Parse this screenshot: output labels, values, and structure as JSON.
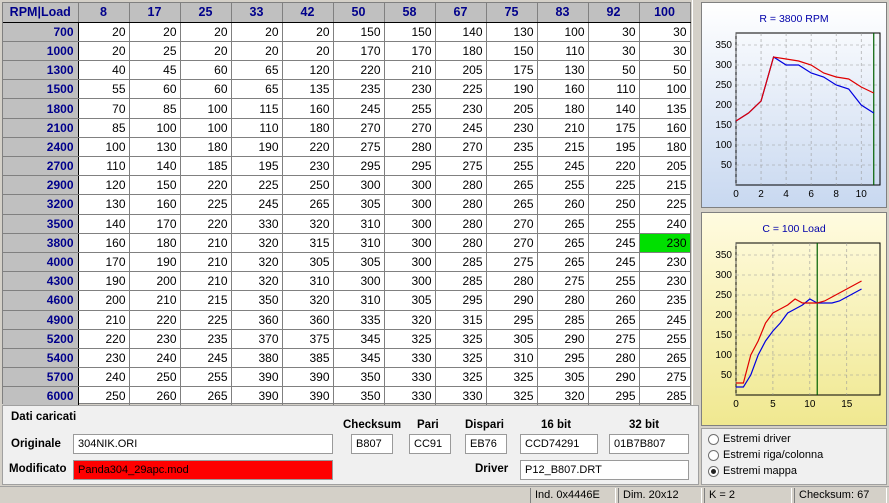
{
  "grid": {
    "corner": "RPM|Load",
    "loads": [
      "8",
      "17",
      "25",
      "33",
      "42",
      "50",
      "58",
      "67",
      "75",
      "83",
      "92",
      "100"
    ],
    "rpms": [
      "700",
      "1000",
      "1300",
      "1500",
      "1800",
      "2100",
      "2400",
      "2700",
      "2900",
      "3200",
      "3500",
      "3800",
      "4000",
      "4300",
      "4600",
      "4900",
      "5200",
      "5400",
      "5700",
      "6000"
    ],
    "values": [
      [
        20,
        20,
        20,
        20,
        20,
        150,
        150,
        140,
        130,
        100,
        30,
        30
      ],
      [
        20,
        25,
        20,
        20,
        20,
        170,
        170,
        180,
        150,
        110,
        30,
        30
      ],
      [
        40,
        45,
        60,
        65,
        120,
        220,
        210,
        205,
        175,
        130,
        50,
        50
      ],
      [
        55,
        60,
        60,
        65,
        135,
        235,
        230,
        225,
        190,
        160,
        110,
        100
      ],
      [
        70,
        85,
        100,
        115,
        160,
        245,
        255,
        230,
        205,
        180,
        140,
        135
      ],
      [
        85,
        100,
        100,
        110,
        180,
        270,
        270,
        245,
        230,
        210,
        175,
        160
      ],
      [
        100,
        130,
        180,
        190,
        220,
        275,
        280,
        270,
        235,
        215,
        195,
        180
      ],
      [
        110,
        140,
        185,
        195,
        230,
        295,
        295,
        275,
        255,
        245,
        220,
        205
      ],
      [
        120,
        150,
        220,
        225,
        250,
        300,
        300,
        280,
        265,
        255,
        225,
        215
      ],
      [
        130,
        160,
        225,
        245,
        265,
        305,
        300,
        280,
        265,
        260,
        250,
        225
      ],
      [
        140,
        170,
        220,
        330,
        320,
        310,
        300,
        280,
        270,
        265,
        255,
        240
      ],
      [
        160,
        180,
        210,
        320,
        315,
        310,
        300,
        280,
        270,
        265,
        245,
        230
      ],
      [
        170,
        190,
        210,
        320,
        305,
        305,
        300,
        285,
        275,
        265,
        245,
        230
      ],
      [
        190,
        200,
        210,
        320,
        310,
        300,
        300,
        285,
        280,
        275,
        255,
        230
      ],
      [
        200,
        210,
        215,
        350,
        320,
        310,
        305,
        295,
        290,
        280,
        260,
        235
      ],
      [
        210,
        220,
        225,
        360,
        360,
        335,
        320,
        315,
        295,
        285,
        265,
        245
      ],
      [
        220,
        230,
        235,
        370,
        375,
        345,
        325,
        325,
        305,
        290,
        275,
        255
      ],
      [
        230,
        240,
        245,
        380,
        385,
        345,
        330,
        325,
        310,
        295,
        280,
        265
      ],
      [
        240,
        250,
        255,
        390,
        390,
        350,
        330,
        325,
        325,
        305,
        290,
        275
      ],
      [
        250,
        260,
        265,
        390,
        390,
        350,
        330,
        330,
        325,
        320,
        295,
        285
      ]
    ],
    "highlight": {
      "row": 11,
      "col": 11
    }
  },
  "chart_top": {
    "title": "R = 3800 RPM",
    "yticks": [
      "350",
      "300",
      "250",
      "200",
      "150",
      "100",
      "50"
    ],
    "xticks": [
      "0",
      "2",
      "4",
      "6",
      "8",
      "10"
    ],
    "red": [
      160,
      180,
      210,
      320,
      315,
      310,
      300,
      280,
      270,
      265,
      245,
      230
    ],
    "blue": [
      160,
      180,
      210,
      320,
      300,
      300,
      280,
      270,
      250,
      240,
      200,
      180
    ],
    "colors": {
      "red": "#e00000",
      "blue": "#0000e0"
    }
  },
  "chart_bottom": {
    "title": "C = 100 Load",
    "yticks": [
      "350",
      "300",
      "250",
      "200",
      "150",
      "100",
      "50"
    ],
    "xticks": [
      "0",
      "5",
      "10",
      "15"
    ],
    "red": [
      30,
      30,
      100,
      135,
      180,
      205,
      215,
      225,
      240,
      230,
      230,
      230,
      235,
      245,
      255,
      265,
      275,
      285
    ],
    "blue": [
      20,
      20,
      50,
      100,
      135,
      160,
      180,
      205,
      215,
      225,
      240,
      230,
      230,
      230,
      235,
      245,
      255,
      265
    ]
  },
  "info": {
    "section_title": "Dati caricati",
    "original_label": "Originale",
    "original_value": "304NIK.ORI",
    "modified_label": "Modificato",
    "modified_value": "Panda304_29apc.mod",
    "checksum_label": "Checksum",
    "checksum_value": "B807",
    "pari_label": "Pari",
    "pari_value": "CC91",
    "dispari_label": "Dispari",
    "dispari_value": "EB76",
    "bit16_label": "16 bit",
    "bit16_value": "CCD74291",
    "bit32_label": "32 bit",
    "bit32_value": "01B7B807",
    "driver_label": "Driver",
    "driver_value": "P12_B807.DRT"
  },
  "radios": [
    {
      "label": "Estremi driver",
      "checked": false
    },
    {
      "label": "Estremi riga/colonna",
      "checked": false
    },
    {
      "label": "Estremi mappa",
      "checked": true
    }
  ],
  "status": {
    "ind": "Ind. 0x4446E",
    "dim": "Dim. 20x12",
    "k": "K = 2",
    "checksum": "Checksum: 67"
  }
}
